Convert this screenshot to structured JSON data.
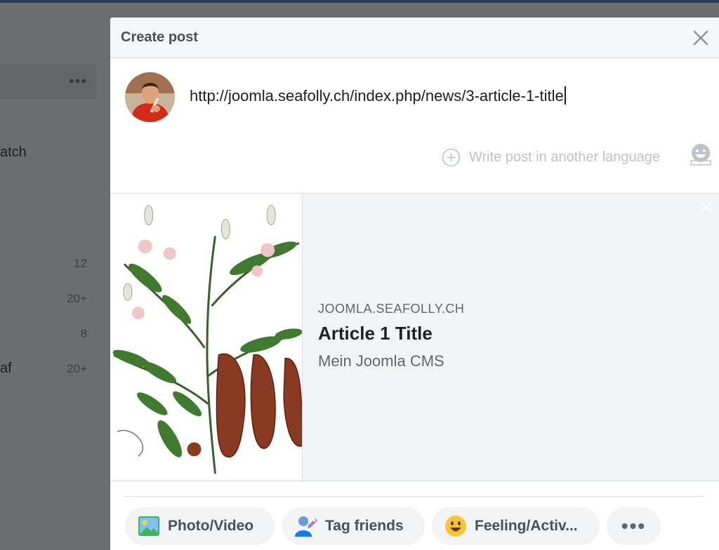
{
  "background": {
    "partial_labels": [
      "atch",
      "af"
    ],
    "counts": [
      "12",
      "20+",
      "8",
      "20+"
    ]
  },
  "modal": {
    "title": "Create post",
    "post_text": "http://joomla.seafolly.ch/index.php/news/3-article-1-title",
    "other_language_label": "Write post in another language"
  },
  "link_preview": {
    "domain": "JOOMLA.SEAFOLLY.CH",
    "title": "Article 1 Title",
    "description": "Mein Joomla CMS"
  },
  "actions": {
    "photo_video": "Photo/Video",
    "tag_friends": "Tag friends",
    "feeling": "Feeling/Activ...",
    "more": "•••"
  },
  "icons": {
    "close": "close-icon",
    "plus": "plus-circle-icon",
    "emoji": "emoji-icon",
    "photo": "photo-icon",
    "tag": "tag-friends-icon",
    "feeling": "feeling-icon",
    "more": "more-icon"
  },
  "colors": {
    "header_bg": "#f5f6f7",
    "title_text": "#1d2129",
    "muted_text": "#606770",
    "preview_bg": "#f2f3f5"
  }
}
